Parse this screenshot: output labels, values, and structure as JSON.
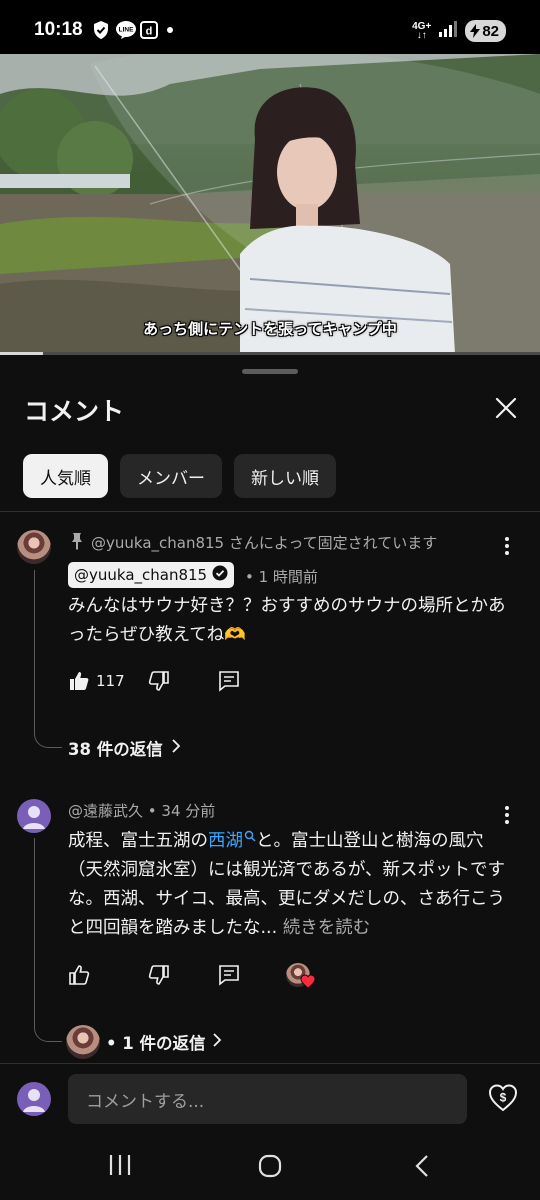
{
  "status": {
    "time": "10:18",
    "network": "4G+",
    "battery": "82",
    "icons": [
      "shield-check-icon",
      "line-icon",
      "docomo-d-icon",
      "notification-dot-icon",
      "signal-icon",
      "battery-charging-icon"
    ]
  },
  "video": {
    "caption": "あっち側にテントを張ってキャンプ中",
    "progress": 0.08
  },
  "comments_panel": {
    "title": "コメント",
    "chips": [
      "人気順",
      "メンバー",
      "新しい順"
    ],
    "active_chip": "人気順"
  },
  "pinned_comment": {
    "pinned_text": "@yuuka_chan815 さんによって固定されています",
    "author": "@yuuka_chan815",
    "verified": true,
    "time": "• 1 時間前",
    "text": "みんなはサウナ好き？？おすすめのサウナの場所とかあったらぜひ教えてね",
    "emoji": "🫶",
    "likes": "117",
    "replies": "38 件の返信"
  },
  "second_comment": {
    "author": "@遠藤武久",
    "time": "• 34 分前",
    "text_before_link": "成程、富士五湖の",
    "link_text": "西湖",
    "text_after_link": "と。富士山登山と樹海の風穴（天然洞窟氷室）には観光済であるが、新スポットですな。西湖、サイコ、最高、更にダメだしの、さあ行こうと四回韻を踏みましたな...",
    "read_more": "続きを読む",
    "replies": "• 1 件の返信"
  },
  "input": {
    "placeholder": "コメントする..."
  }
}
